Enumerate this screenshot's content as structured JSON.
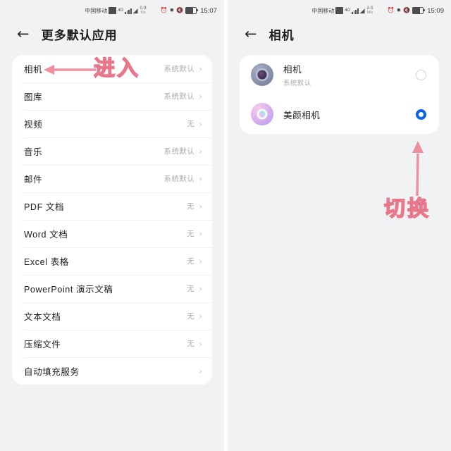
{
  "theme": {
    "page_bg": "#f1f2f3",
    "card_bg": "#ffffff",
    "accent_blue": "#0a63e5",
    "annotation_pink": "#f4a3ad",
    "annotation_stroke": "#e8778c"
  },
  "left_screen": {
    "statusbar": {
      "carrier": "中国移动",
      "sim_icon": "sim-card-icon",
      "volte_icon": "volte-icon",
      "signal_icon": "signal-bars-icon",
      "wifi_icon": "wifi-icon",
      "net_speed_value": "0.9",
      "net_speed_unit": "K/s",
      "alarm_icon": "alarm-icon",
      "bluetooth_icon": "bluetooth-icon",
      "mute_icon": "mute-icon",
      "battery_icon": "battery-icon",
      "clock": "15:07"
    },
    "title": "更多默认应用",
    "back_icon": "back-arrow-icon",
    "rows": [
      {
        "label": "相机",
        "value": "系统默认"
      },
      {
        "label": "图库",
        "value": "系统默认"
      },
      {
        "label": "视频",
        "value": "无"
      },
      {
        "label": "音乐",
        "value": "系统默认"
      },
      {
        "label": "邮件",
        "value": "系统默认"
      },
      {
        "label": "PDF 文档",
        "value": "无"
      },
      {
        "label": "Word 文档",
        "value": "无"
      },
      {
        "label": "Excel 表格",
        "value": "无"
      },
      {
        "label": "PowerPoint 演示文稿",
        "value": "无"
      },
      {
        "label": "文本文档",
        "value": "无"
      },
      {
        "label": "压缩文件",
        "value": "无"
      },
      {
        "label": "自动填充服务",
        "value": ""
      }
    ],
    "annotation": {
      "text": "进入",
      "arrow_icon": "left-arrow-annotation-icon"
    }
  },
  "right_screen": {
    "statusbar": {
      "carrier": "中国移动",
      "sim_icon": "sim-card-icon",
      "volte_icon": "volte-icon",
      "signal_icon": "signal-bars-icon",
      "wifi_icon": "wifi-icon",
      "net_speed_value": "2.5",
      "net_speed_unit": "M/s",
      "alarm_icon": "alarm-icon",
      "bluetooth_icon": "bluetooth-icon",
      "mute_icon": "mute-icon",
      "battery_icon": "battery-icon",
      "clock": "15:09"
    },
    "title": "相机",
    "back_icon": "back-arrow-icon",
    "options": [
      {
        "name": "相机",
        "sub": "系统默认",
        "icon": "camera-app-icon",
        "selected": false
      },
      {
        "name": "美颜相机",
        "sub": "",
        "icon": "beauty-camera-app-icon",
        "selected": true
      }
    ],
    "annotation": {
      "text": "切换",
      "arrow_icon": "up-arrow-annotation-icon"
    }
  }
}
